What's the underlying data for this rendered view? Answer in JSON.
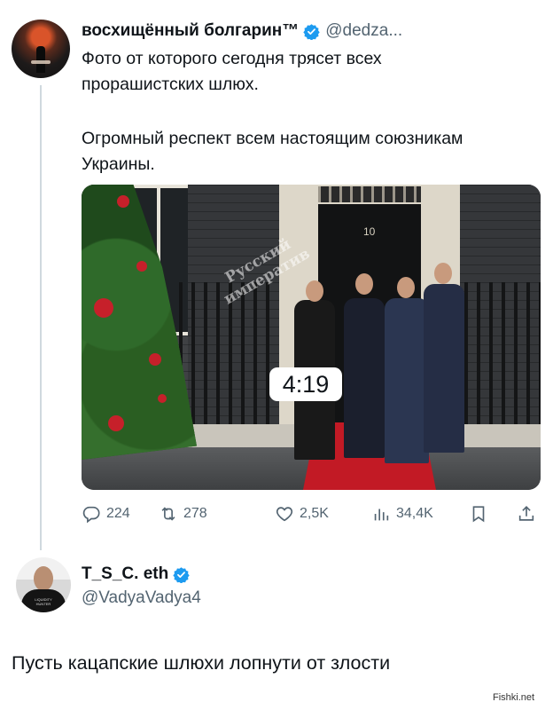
{
  "tweet": {
    "display_name": "восхищённый болгарин™",
    "handle": "@dedza...",
    "text_line1": "Фото от которого сегодня трясет всех\nпрорашистских шлюх.",
    "text_line2": "Огромный респект всем настоящим союзникам\nУкраины.",
    "media": {
      "duration": "4:19",
      "door_number": "10",
      "watermark": "Русский\nимператив"
    },
    "stats": {
      "replies": "224",
      "retweets": "278",
      "likes": "2,5K",
      "views": "34,4K"
    }
  },
  "reply": {
    "display_name": "T_S_C. eth",
    "handle": "@VadyaVadya4",
    "avatar_shirt_text": "LIQUIDITY HUNTER",
    "text": "Пусть кацапские шлюхи лопнути от злости"
  },
  "site_tag": "Fishki.net",
  "colors": {
    "verified_blue": "#1d9bf0",
    "text_primary": "#0f1419",
    "text_secondary": "#536471"
  }
}
